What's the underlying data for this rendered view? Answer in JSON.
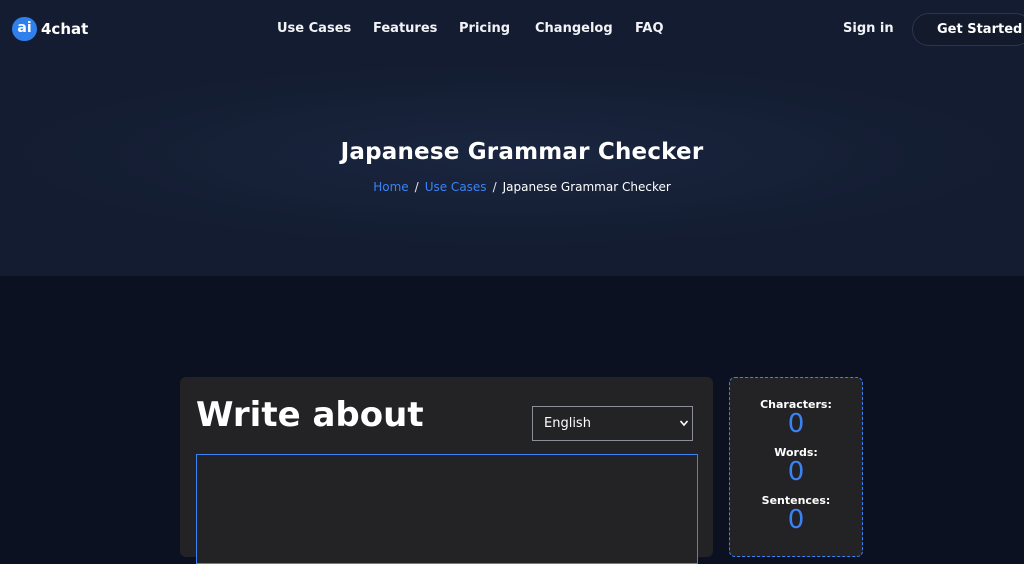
{
  "logo": {
    "badge": "ai",
    "name": "4chat"
  },
  "nav": {
    "items": [
      "Use Cases",
      "Features",
      "Pricing",
      "Changelog",
      "FAQ"
    ],
    "sign_in": "Sign in",
    "cta": "Get Started"
  },
  "hero": {
    "title": "Japanese Grammar Checker",
    "breadcrumb": {
      "home": "Home",
      "section": "Use Cases",
      "current": "Japanese Grammar Checker",
      "separator": "/"
    }
  },
  "editor": {
    "title": "Write about",
    "language": "English",
    "text": ""
  },
  "stats": {
    "characters_label": "Characters:",
    "characters": "0",
    "words_label": "Words:",
    "words": "0",
    "sentences_label": "Sentences:",
    "sentences": "0"
  },
  "colors": {
    "accent": "#3b82f6",
    "background": "#0b1120",
    "card": "#232224"
  }
}
